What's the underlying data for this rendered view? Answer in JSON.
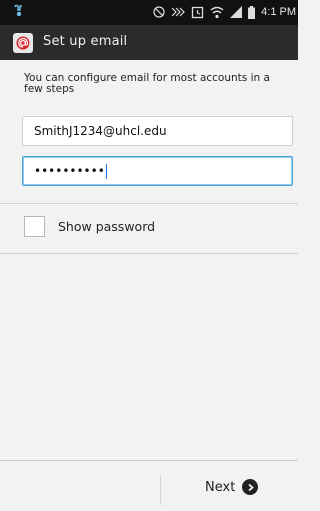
{
  "status_bar": {
    "time": "4:1 PM",
    "icons": [
      "usb-icon",
      "bluetooth-icon",
      "mute-icon",
      "alarm-icon",
      "wifi-icon",
      "signal-icon",
      "battery-icon"
    ]
  },
  "action_bar": {
    "title": "Set up email",
    "app_icon": "email-app-icon"
  },
  "form": {
    "intro": "You can configure email for most accounts in a few steps",
    "email_value": "SmithJ1234@uhcl.edu",
    "password_value": "••••••••••",
    "show_password_label": "Show password",
    "show_password_checked": false
  },
  "bottom": {
    "next_label": "Next"
  },
  "colors": {
    "status_bar": "#111111",
    "action_bar": "#2b2b2b",
    "focus_border": "#4fa6d6",
    "background": "#f2f2f2"
  }
}
